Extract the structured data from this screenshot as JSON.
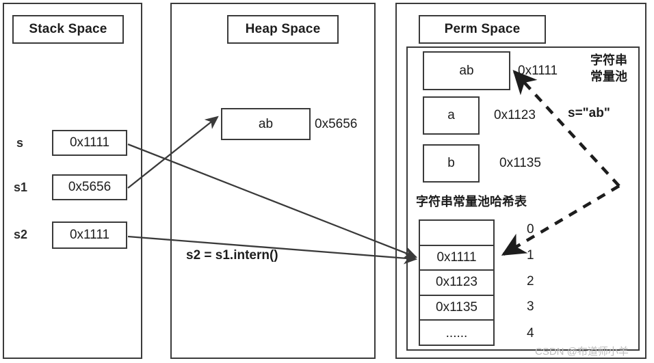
{
  "panels": {
    "stack": {
      "title": "Stack Space"
    },
    "heap": {
      "title": "Heap Space"
    },
    "perm": {
      "title": "Perm Space"
    }
  },
  "stack": {
    "rows": [
      {
        "var": "s",
        "value": "0x1111"
      },
      {
        "var": "s1",
        "value": "0x5656"
      },
      {
        "var": "s2",
        "value": "0x1111"
      }
    ]
  },
  "heap": {
    "object": {
      "content": "ab",
      "address": "0x5656"
    }
  },
  "perm": {
    "pool_label_line1": "字符串",
    "pool_label_line2": "常量池",
    "assignment": "s=\"ab\"",
    "entries": [
      {
        "content": "ab",
        "address": "0x1111"
      },
      {
        "content": "a",
        "address": "0x1123"
      },
      {
        "content": "b",
        "address": "0x1135"
      }
    ],
    "hash_table_title": "字符串常量池哈希表",
    "hash_table_rows": [
      {
        "value": "",
        "index": "0"
      },
      {
        "value": "0x1111",
        "index": "1"
      },
      {
        "value": "0x1123",
        "index": "2"
      },
      {
        "value": "0x1135",
        "index": "3"
      },
      {
        "value": "......",
        "index": "4"
      }
    ]
  },
  "annotations": {
    "intern_call": "s2 = s1.intern()"
  },
  "watermark": "CSDN @布道师小羊",
  "colors": {
    "stroke": "#3a3a3a",
    "text": "#1d1d1d",
    "watermark": "#bdbdbd",
    "background": "#ffffff"
  }
}
